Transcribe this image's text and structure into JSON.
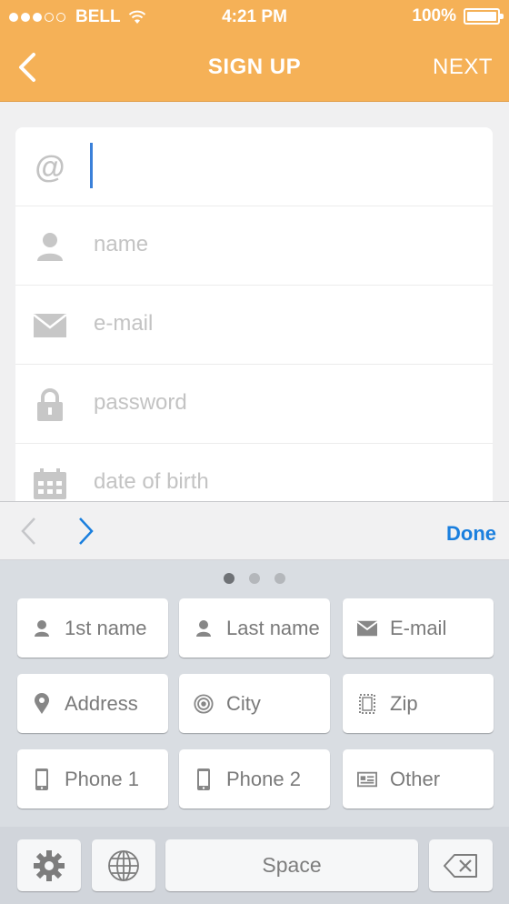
{
  "status_bar": {
    "carrier": "BELL",
    "time": "4:21 PM",
    "battery": "100%",
    "battery_level": 1.0,
    "signal_bars": 3,
    "signal_total": 5
  },
  "nav": {
    "title": "SIGN UP",
    "next_label": "NEXT",
    "back_icon": "chevron-left-icon"
  },
  "form": {
    "fields": [
      {
        "icon": "at-icon",
        "icon_text": "@",
        "placeholder": "",
        "focused": true
      },
      {
        "icon": "person-icon",
        "placeholder": "name"
      },
      {
        "icon": "envelope-icon",
        "placeholder": "e-mail"
      },
      {
        "icon": "lock-icon",
        "placeholder": "password"
      },
      {
        "icon": "calendar-icon",
        "placeholder": "date of birth"
      }
    ]
  },
  "accessory": {
    "done_label": "Done",
    "prev_icon": "chevron-left-icon",
    "next_icon": "chevron-right-icon"
  },
  "keyboard": {
    "page_count": 3,
    "active_page": 0,
    "keys": [
      {
        "label": "1st name",
        "icon": "person-icon"
      },
      {
        "label": "Last name",
        "icon": "person-icon"
      },
      {
        "label": "E-mail",
        "icon": "envelope-icon"
      },
      {
        "label": "Address",
        "icon": "map-pin-icon"
      },
      {
        "label": "City",
        "icon": "target-icon"
      },
      {
        "label": "Zip",
        "icon": "stamp-icon"
      },
      {
        "label": "Phone 1",
        "icon": "phone-icon"
      },
      {
        "label": "Phone 2",
        "icon": "phone-icon"
      },
      {
        "label": "Other",
        "icon": "card-icon"
      }
    ],
    "space_label": "Space",
    "settings_icon": "gear-icon",
    "globe_icon": "globe-icon",
    "delete_icon": "backspace-icon"
  },
  "colors": {
    "header": "#f5b157",
    "accent": "#1a7fde",
    "caret": "#3a80d9",
    "keyboard_bg": "#d9dde2"
  }
}
